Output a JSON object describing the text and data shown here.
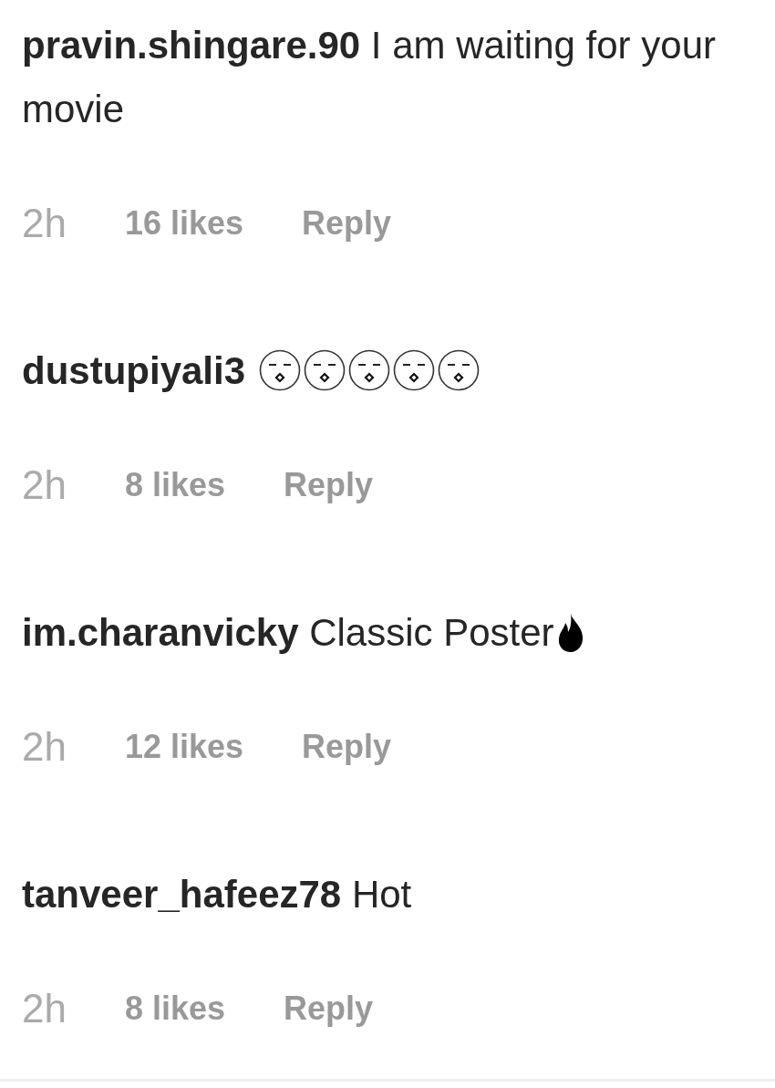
{
  "comments": [
    {
      "username": "pravin.shingare.90",
      "text": "I am waiting for your movie",
      "time": "2h",
      "likes": "16 likes",
      "reply": "Reply"
    },
    {
      "username": "dustupiyali3",
      "emojis": [
        {
          "kind": "hushed"
        },
        {
          "kind": "hushed"
        },
        {
          "kind": "hushed"
        },
        {
          "kind": "hushed"
        },
        {
          "kind": "hushed"
        }
      ],
      "time": "2h",
      "likes": "8 likes",
      "reply": "Reply"
    },
    {
      "username": "im.charanvicky",
      "text": "Classic Poster",
      "emojis": [
        {
          "kind": "fire"
        }
      ],
      "time": "2h",
      "likes": "12 likes",
      "reply": "Reply"
    },
    {
      "username": "tanveer_hafeez78",
      "text": "Hot",
      "time": "2h",
      "likes": "8 likes",
      "reply": "Reply"
    }
  ]
}
